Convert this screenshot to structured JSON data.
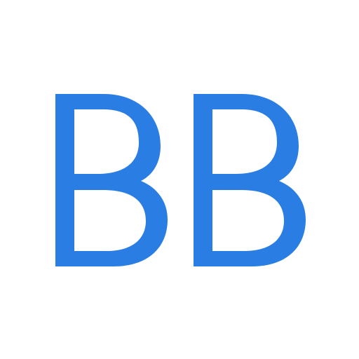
{
  "logo": {
    "text": "BB",
    "color": "#2a7ee3",
    "background": "#ffffff"
  }
}
